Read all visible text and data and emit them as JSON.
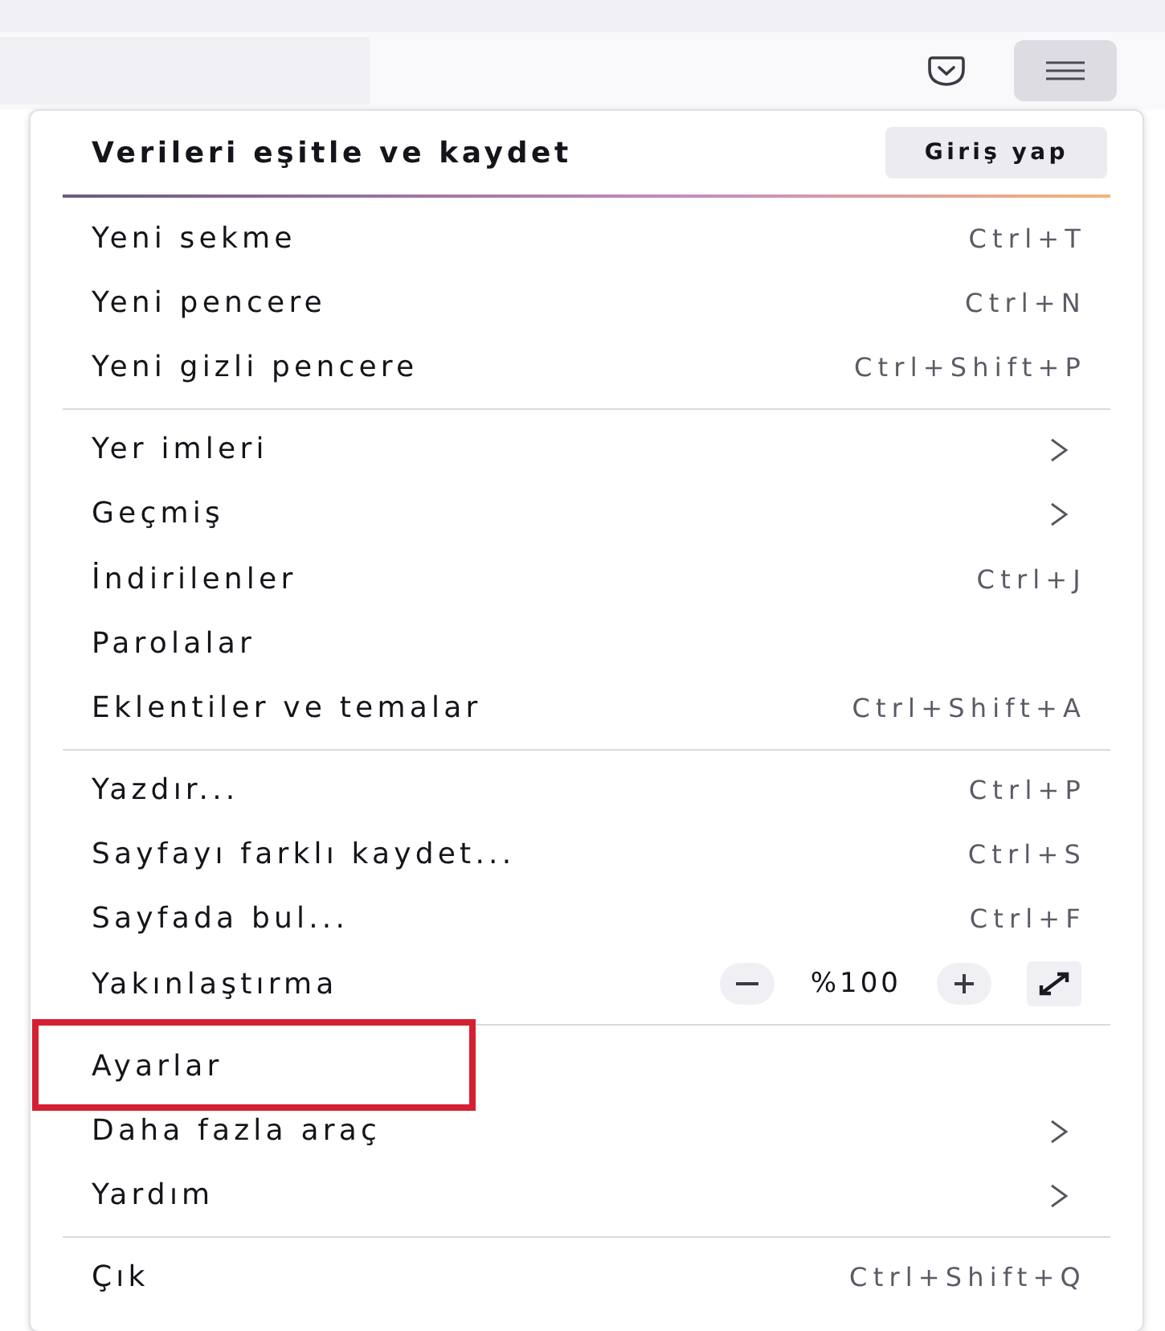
{
  "toolbar": {
    "menu_button": {
      "selected": true
    }
  },
  "menu": {
    "header": {
      "label": "Verileri eşitle ve kaydet",
      "button": "Giriş yap"
    },
    "sections": [
      {
        "items": [
          {
            "kind": "shortcut",
            "label": "Yeni sekme",
            "shortcut": "Ctrl+T",
            "highlighted": false
          },
          {
            "kind": "shortcut",
            "label": "Yeni pencere",
            "shortcut": "Ctrl+N",
            "highlighted": false
          },
          {
            "kind": "shortcut",
            "label": "Yeni gizli pencere",
            "shortcut": "Ctrl+Shift+P",
            "highlighted": false
          }
        ]
      },
      {
        "items": [
          {
            "kind": "submenu",
            "label": "Yer imleri",
            "highlighted": false
          },
          {
            "kind": "submenu",
            "label": "Geçmiş",
            "highlighted": false
          },
          {
            "kind": "shortcut",
            "label": "İndirilenler",
            "shortcut": "Ctrl+J",
            "highlighted": false
          },
          {
            "kind": "plain",
            "label": "Parolalar",
            "highlighted": false
          },
          {
            "kind": "shortcut",
            "label": "Eklentiler ve temalar",
            "shortcut": "Ctrl+Shift+A",
            "highlighted": false
          }
        ]
      },
      {
        "items": [
          {
            "kind": "shortcut",
            "label": "Yazdır...",
            "shortcut": "Ctrl+P",
            "highlighted": false
          },
          {
            "kind": "shortcut",
            "label": "Sayfayı farklı kaydet...",
            "shortcut": "Ctrl+S",
            "highlighted": false
          },
          {
            "kind": "shortcut",
            "label": "Sayfada bul...",
            "shortcut": "Ctrl+F",
            "highlighted": false
          },
          {
            "kind": "zoom",
            "label": "Yakınlaştırma",
            "value": "%100",
            "highlighted": false
          }
        ]
      },
      {
        "items": [
          {
            "kind": "plain",
            "label": "Ayarlar",
            "highlighted": true
          },
          {
            "kind": "submenu",
            "label": "Daha fazla araç",
            "highlighted": false
          },
          {
            "kind": "submenu",
            "label": "Yardım",
            "highlighted": false
          }
        ]
      },
      {
        "items": [
          {
            "kind": "shortcut",
            "label": "Çık",
            "shortcut": "Ctrl+Shift+Q",
            "highlighted": false
          }
        ]
      }
    ]
  }
}
